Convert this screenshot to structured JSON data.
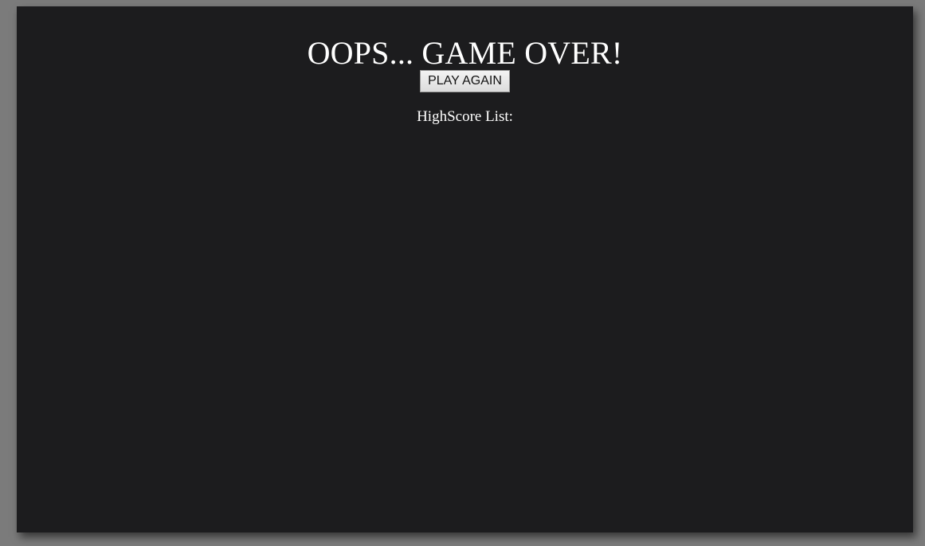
{
  "game_over": {
    "title": "OOPS... GAME OVER!",
    "play_again_label": "PLAY AGAIN",
    "highscore_label": "HighScore List:"
  },
  "colors": {
    "page_background": "#7b7b7b",
    "panel_background": "#1c1c1e",
    "text": "#ffffff"
  }
}
